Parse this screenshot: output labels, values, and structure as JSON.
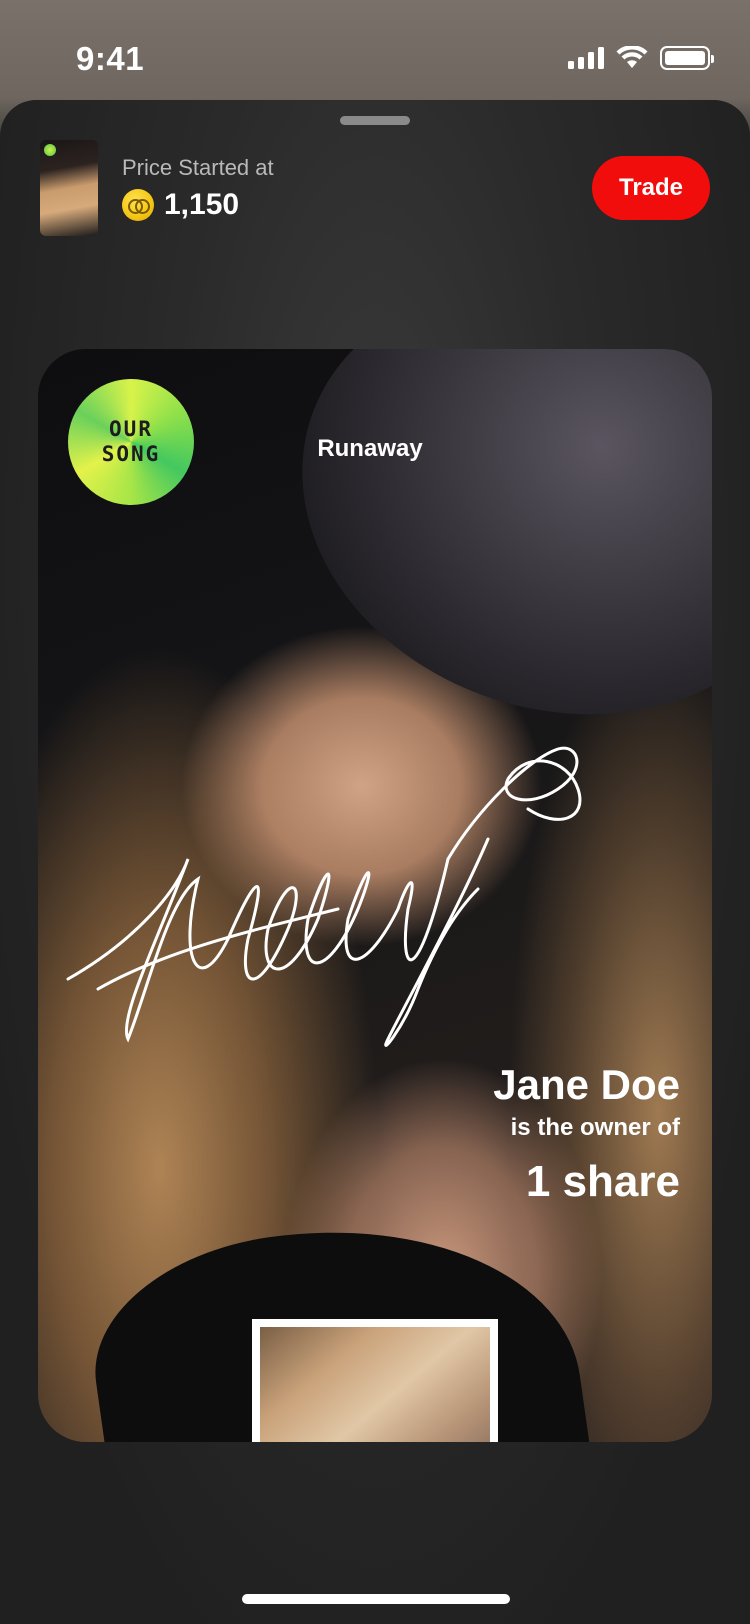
{
  "status_bar": {
    "time": "9:41",
    "icons": [
      "cellular-signal-icon",
      "wifi-icon",
      "battery-icon"
    ]
  },
  "header": {
    "price_label": "Price Started at",
    "price_value": "1,150",
    "trade_label": "Trade",
    "coin_icon": "coin-icon"
  },
  "card": {
    "badge_line1": "OUR",
    "badge_line2": "SONG",
    "song_title": "Runaway",
    "owner_name": "Jane Doe",
    "owner_subtitle": "is the owner of",
    "owner_share": "1 share"
  },
  "colors": {
    "accent": "#f20d0d",
    "coin": "#f4c514",
    "badge": "#8ee04a"
  }
}
